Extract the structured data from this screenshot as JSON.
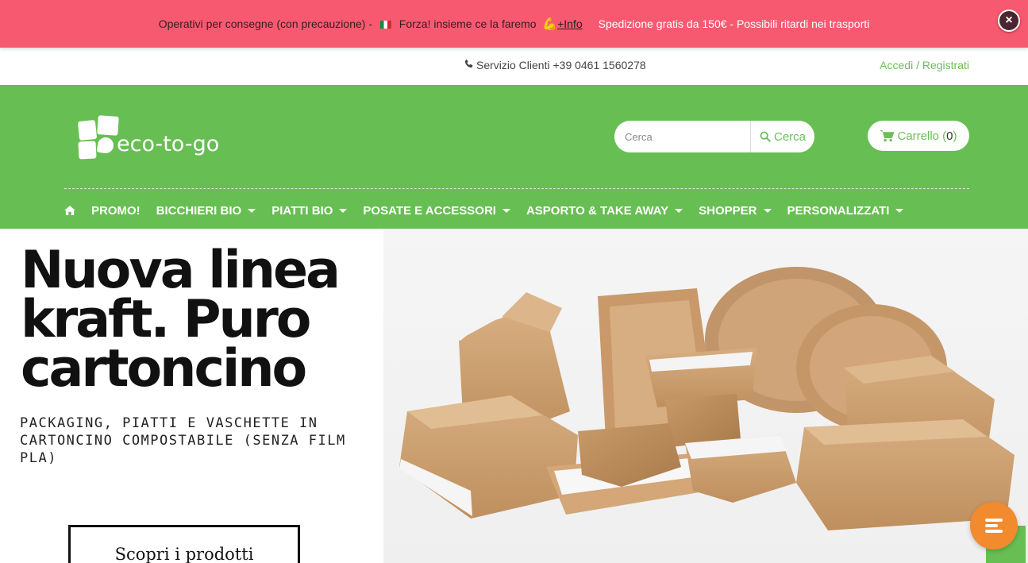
{
  "announcement": {
    "message_part1": "Operativi per consegne (con precauzione) - ",
    "message_part2": " Forza! insieme ce la faremo ",
    "link_label": "+Info",
    "shipping": "Spedizione gratis da 150€  - Possibili ritardi nei trasporti",
    "close_label": "×"
  },
  "topbar": {
    "service": "Servizio Clienti +39 0461 1560278",
    "login": "Accedi / Registrati"
  },
  "header": {
    "logo_text": "eco-to-go",
    "search_placeholder": "Cerca",
    "search_button": "Cerca",
    "cart_label": "Carrello (",
    "cart_count": "0",
    "cart_close": ")"
  },
  "nav": {
    "items": [
      {
        "label": "PROMO!"
      },
      {
        "label": "BICCHIERI BIO"
      },
      {
        "label": "PIATTI BIO"
      },
      {
        "label": "POSATE E ACCESSORI"
      },
      {
        "label": "ASPORTO & TAKE AWAY"
      },
      {
        "label": "SHOPPER"
      },
      {
        "label": "PERSONALIZZATI"
      }
    ]
  },
  "hero": {
    "title": "Nuova linea kraft. Puro cartoncino",
    "subtitle": "PACKAGING, PIATTI E VASCHETTE IN CARTONCINO COMPOSTABILE (SENZA FILM PLA)",
    "cta": "Scopri i prodotti"
  },
  "colors": {
    "announcement_bg": "#f75a70",
    "brand_green": "#67be52",
    "accent_orange": "#f28a2e",
    "kraft": "#c89d6e"
  }
}
